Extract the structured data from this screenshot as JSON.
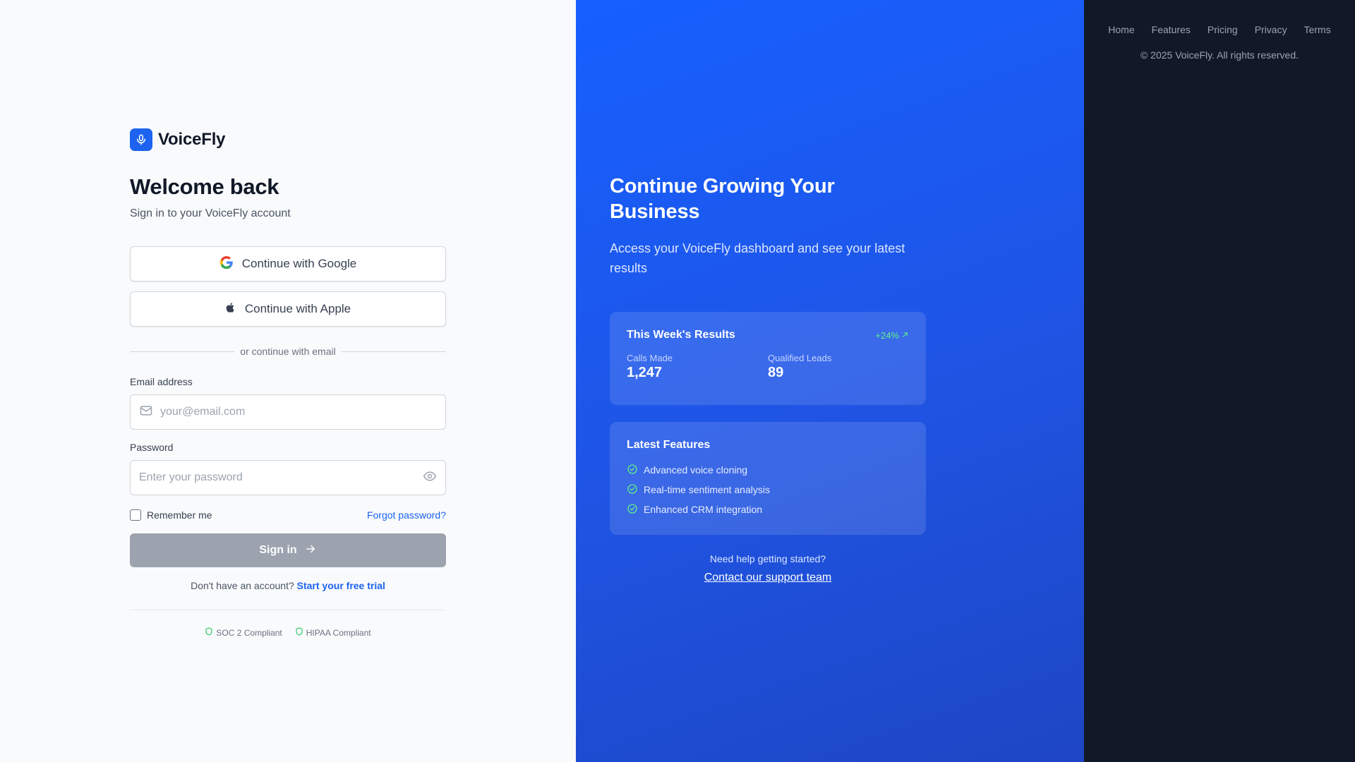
{
  "brand": {
    "name": "VoiceFly",
    "icon": "microphone-icon",
    "color": "#1d63f0"
  },
  "login": {
    "title": "Welcome back",
    "subtitle": "Sign in to your VoiceFly account",
    "google_label": "Continue with Google",
    "apple_label": "Continue with Apple",
    "divider_text": "or continue with email",
    "email": {
      "label": "Email address",
      "placeholder": "your@email.com",
      "value": ""
    },
    "password": {
      "label": "Password",
      "placeholder": "Enter your password",
      "value": ""
    },
    "remember_label": "Remember me",
    "remember_checked": false,
    "forgot_label": "Forgot password?",
    "signin_label": "Sign in",
    "signup_prompt": "Don't have an account?",
    "signup_link": "Start your free trial",
    "compliance": [
      "SOC 2 Compliant",
      "HIPAA Compliant"
    ]
  },
  "promo": {
    "title": "Continue Growing Your Business",
    "subtitle": "Access your VoiceFly dashboard and see your latest results",
    "results": {
      "title": "This Week's Results",
      "growth": "+24%",
      "stats": [
        {
          "label": "Calls Made",
          "value": "1,247"
        },
        {
          "label": "Qualified Leads",
          "value": "89"
        }
      ]
    },
    "features": {
      "title": "Latest Features",
      "items": [
        "Advanced voice cloning",
        "Real-time sentiment analysis",
        "Enhanced CRM integration"
      ]
    },
    "help_text": "Need help getting started?",
    "support_link": "Contact our support team"
  },
  "footer": {
    "links": [
      "Home",
      "Features",
      "Pricing",
      "Privacy",
      "Terms"
    ],
    "copyright": "© 2025 VoiceFly. All rights reserved."
  },
  "colors": {
    "accent": "#1d63f0",
    "promo_bg": "#1660ff",
    "footer_bg": "#111827",
    "growth": "#5ef08c",
    "compliance_ok": "#22c55e"
  }
}
